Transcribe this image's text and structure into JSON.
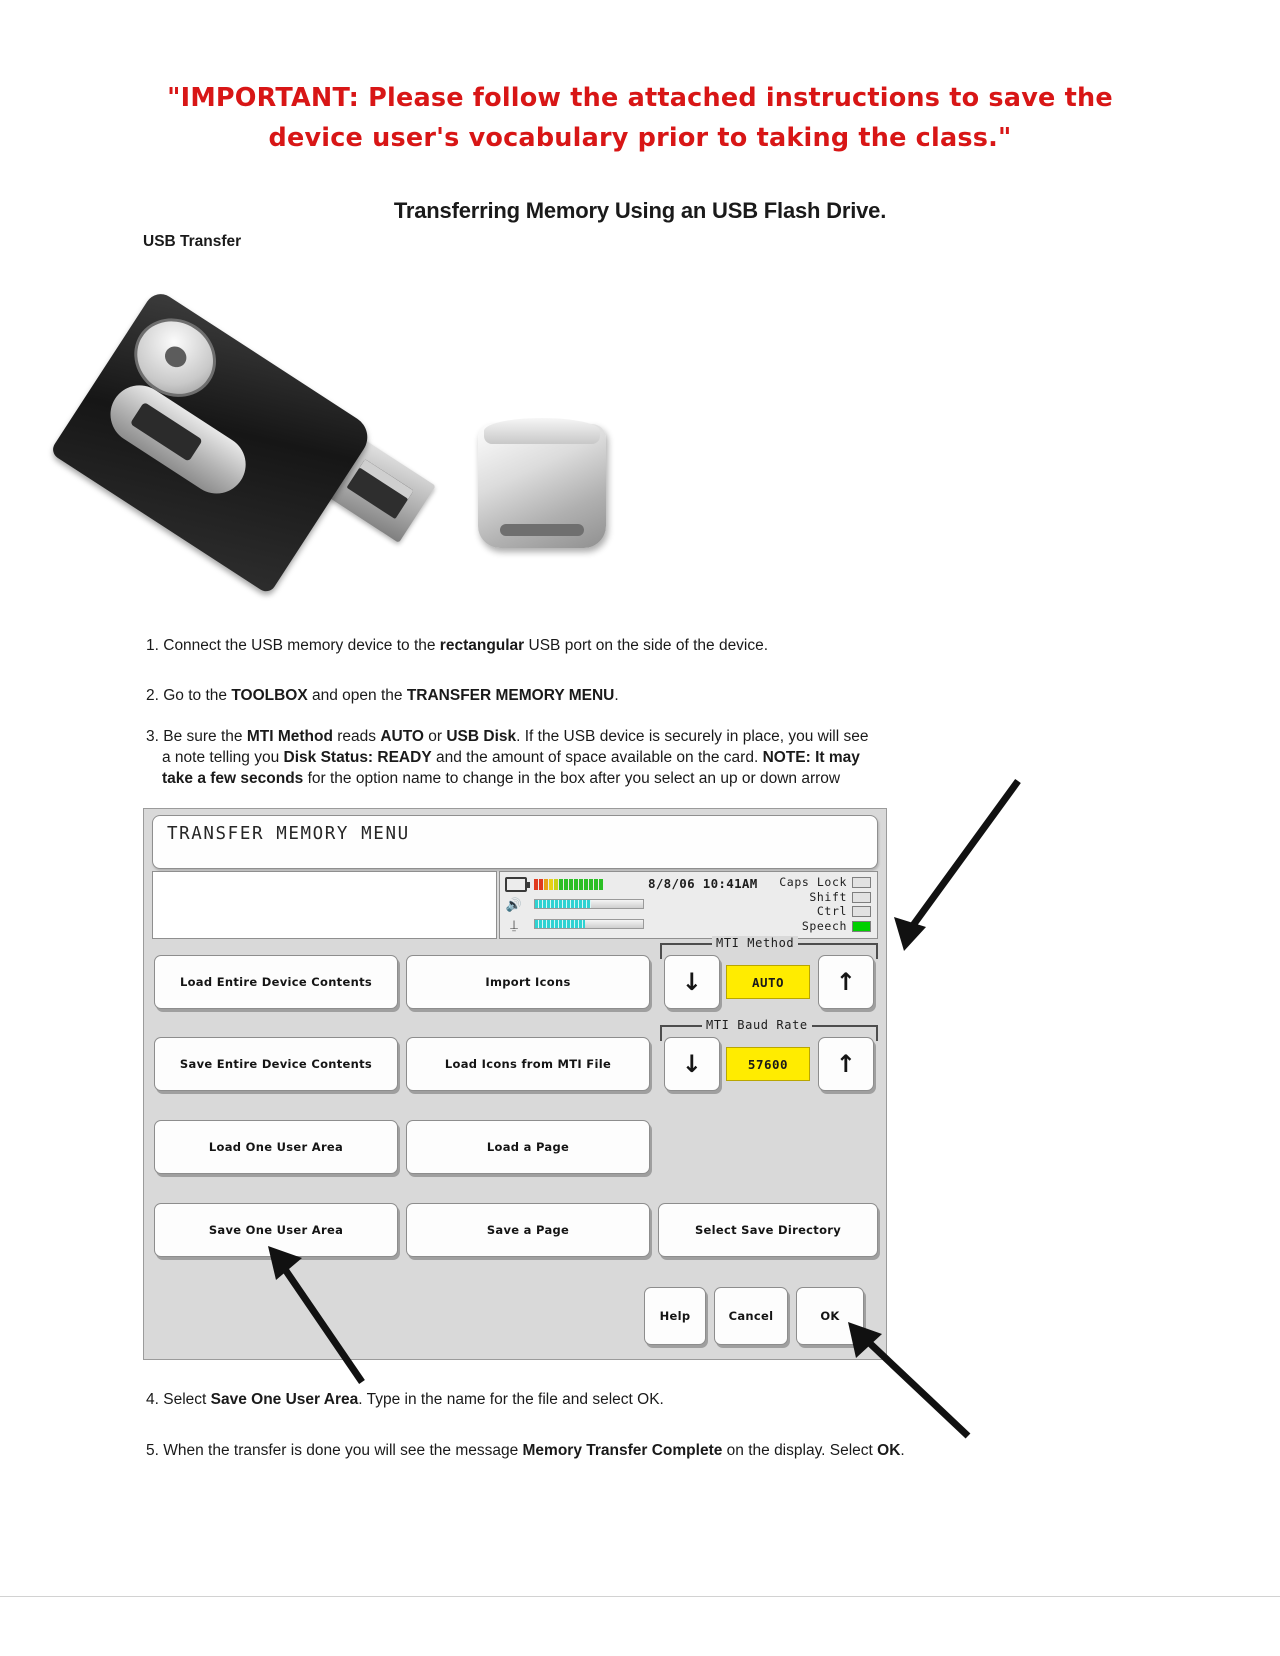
{
  "notice": {
    "line1": "\"IMPORTANT:  Please follow the attached instructions to save the",
    "line2": "device user's vocabulary prior to taking the class.\""
  },
  "document": {
    "title": "Transferring Memory Using an USB Flash Drive.",
    "subtitle": "USB Transfer"
  },
  "steps": {
    "s1_num": "1.",
    "s1_a": " Connect the USB memory device to the ",
    "s1_b": "rectangular",
    "s1_c": " USB port on the side of the device.",
    "s2_num": "2.",
    "s2_a": " Go to the ",
    "s2_b": "TOOLBOX",
    "s2_c": " and open the ",
    "s2_d": "TRANSFER MEMORY MENU",
    "s2_e": ".",
    "s3_num": "3.",
    "s3_a": " Be sure  the ",
    "s3_b": "MTI Method",
    "s3_c": " reads  ",
    "s3_d": "AUTO",
    "s3_e": " or ",
    "s3_f": "USB Disk",
    "s3_g": ". If the USB device is securely in place, you will see",
    "s3_h": "a note telling you ",
    "s3_i": "Disk Status: READY",
    "s3_j": " and the amount of space available on the card.  ",
    "s3_k": "NOTE:  It may",
    "s3_l": "take a few seconds",
    "s3_m": " for the option name to change in the box after you select an up or down arrow",
    "s4_num": "4.",
    "s4_a": " Select ",
    "s4_b": "Save One User Area",
    "s4_c": ".  Type in the name for the file and select OK.",
    "s5_num": "5.",
    "s5_a": " When the transfer is done you will see the message ",
    "s5_b": "Memory Transfer Complete",
    "s5_c": " on the display.  Select ",
    "s5_d": "OK",
    "s5_e": "."
  },
  "device_ui": {
    "window_title": "TRANSFER MEMORY MENU",
    "status": {
      "datetime": "8/8/06 10:41AM",
      "battery_icon": "battery-icon",
      "speaker_icon": "speaker-icon",
      "headphone_icon": "headphone-icon",
      "flags": [
        {
          "label": "Caps Lock",
          "on": false
        },
        {
          "label": "Shift",
          "on": false
        },
        {
          "label": "Ctrl",
          "on": false
        },
        {
          "label": "Speech",
          "on": true
        }
      ]
    },
    "buttons": {
      "load_entire": "Load Entire Device Contents",
      "import_icons": "Import Icons",
      "save_entire": "Save Entire Device Contents",
      "load_icons_mti": "Load Icons from MTI File",
      "load_one_user_area": "Load One User Area",
      "load_a_page": "Load a Page",
      "save_one_user_area": "Save One User Area",
      "save_a_page": "Save a Page",
      "select_save_directory": "Select Save Directory",
      "help": "Help",
      "cancel": "Cancel",
      "ok": "OK",
      "down_arrow": "↓",
      "up_arrow": "↑"
    },
    "mti_method": {
      "label": "MTI Method",
      "value": "AUTO"
    },
    "mti_baud": {
      "label": "MTI Baud Rate",
      "value": "57600"
    }
  }
}
